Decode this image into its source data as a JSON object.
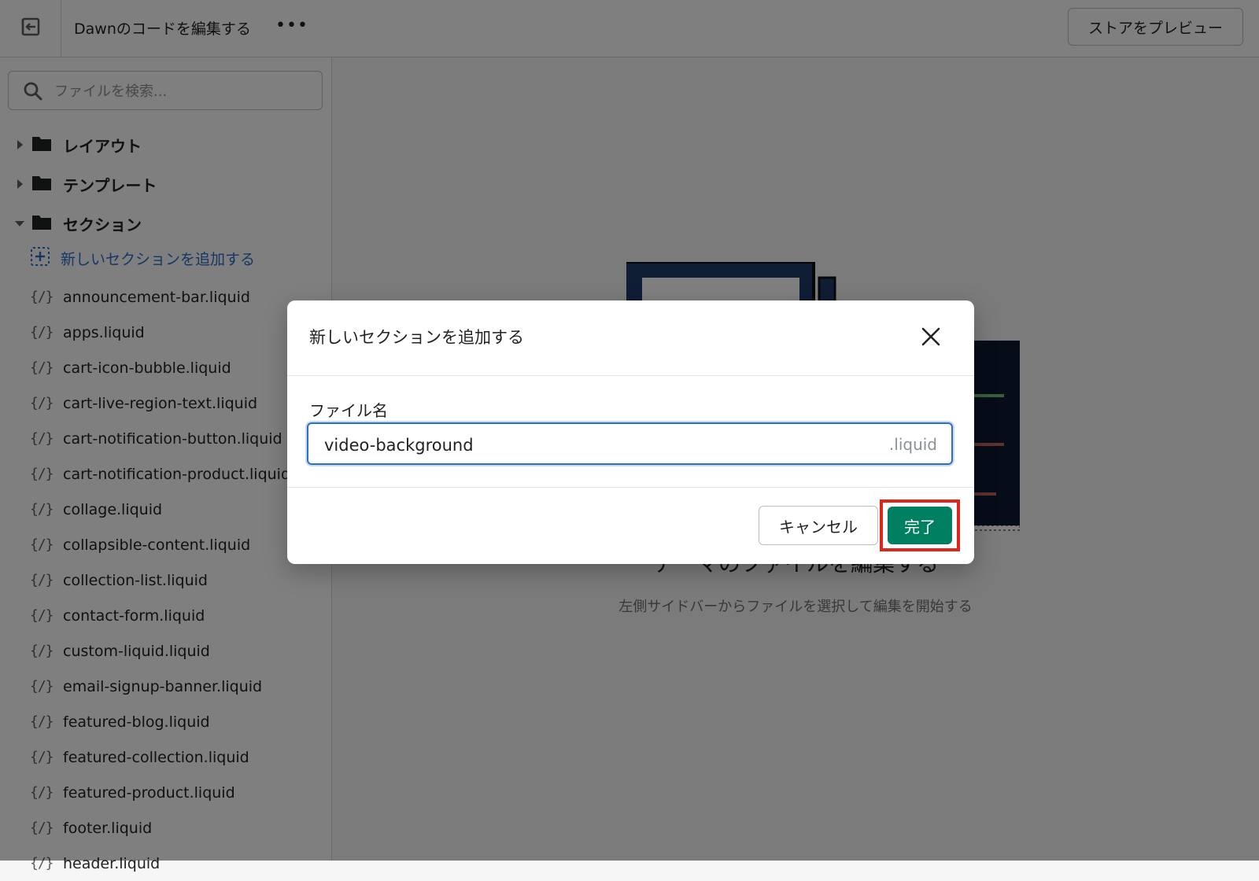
{
  "topbar": {
    "exit_icon": "exit-icon",
    "title": "Dawnのコードを編集する",
    "more_label": "•••",
    "preview_label": "ストアをプレビュー"
  },
  "sidebar": {
    "search_placeholder": "ファイルを検索...",
    "folders": [
      {
        "label": "レイアウト",
        "expanded": false
      },
      {
        "label": "テンプレート",
        "expanded": false
      },
      {
        "label": "セクション",
        "expanded": true
      }
    ],
    "add_section_label": "新しいセクションを追加する",
    "file_icon": "{/}",
    "files": [
      "announcement-bar.liquid",
      "apps.liquid",
      "cart-icon-bubble.liquid",
      "cart-live-region-text.liquid",
      "cart-notification-button.liquid",
      "cart-notification-product.liquid",
      "collage.liquid",
      "collapsible-content.liquid",
      "collection-list.liquid",
      "contact-form.liquid",
      "custom-liquid.liquid",
      "email-signup-banner.liquid",
      "featured-blog.liquid",
      "featured-collection.liquid",
      "featured-product.liquid",
      "footer.liquid",
      "header.liquid"
    ]
  },
  "main": {
    "empty_heading": "テーマのファイルを編集する",
    "empty_subtext": "左側サイドバーからファイルを選択して編集を開始する"
  },
  "modal": {
    "title": "新しいセクションを追加する",
    "close_icon": "close-icon",
    "field_label": "ファイル名",
    "field_value": "video-background",
    "field_suffix": ".liquid",
    "cancel_label": "キャンセル",
    "done_label": "完了"
  },
  "colors": {
    "primary_button": "#008060",
    "focus_border": "#2c6ecb",
    "link": "#2c6ecb",
    "highlight_box": "#e0261b",
    "overlay": "rgba(0,0,0,0.5)"
  }
}
